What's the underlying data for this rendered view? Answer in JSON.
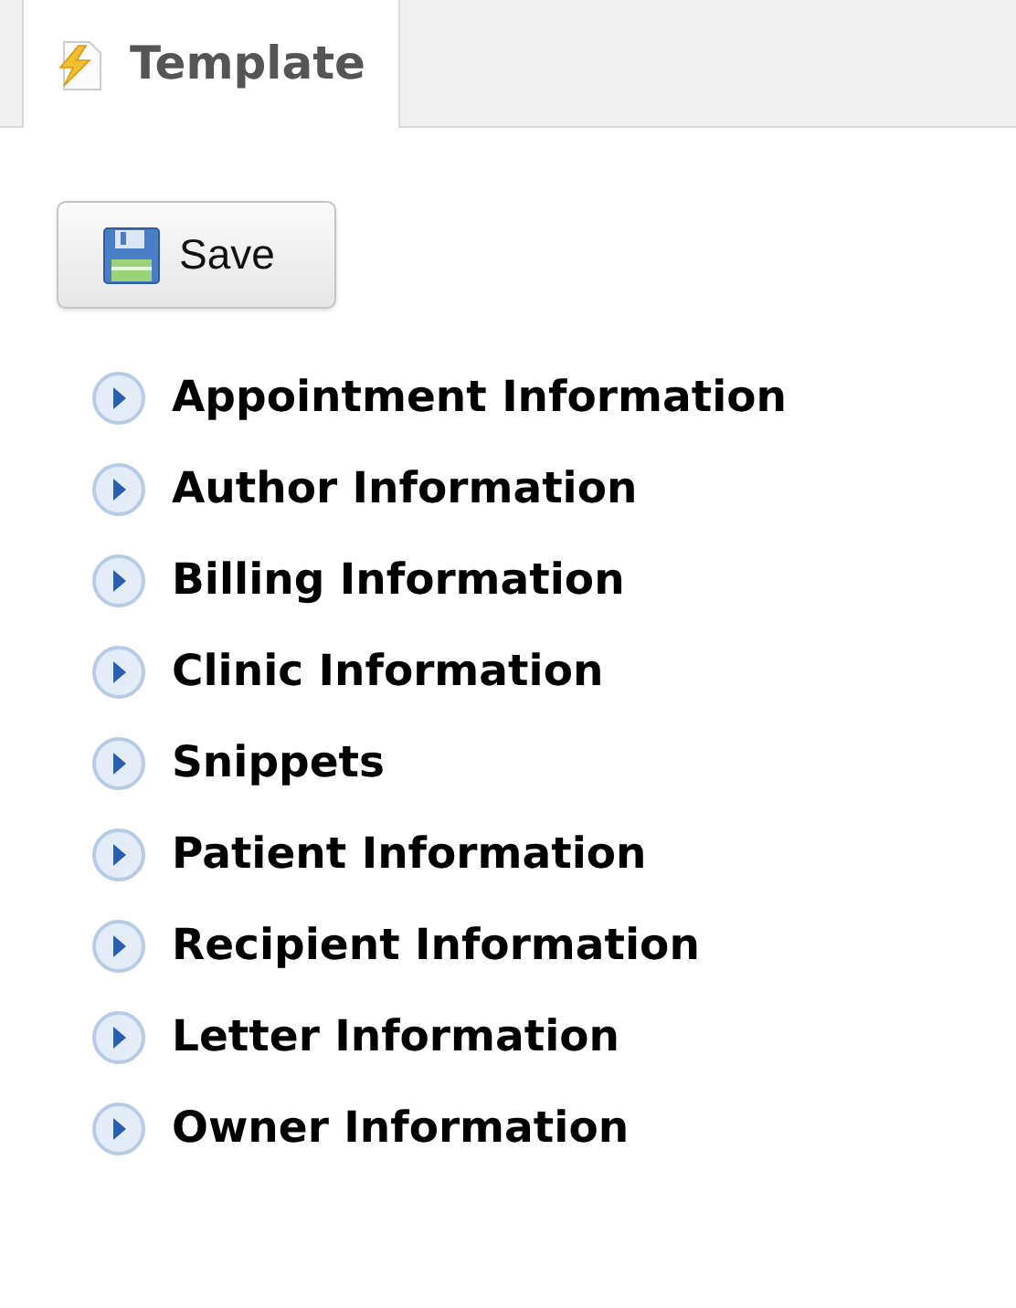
{
  "tabs": [
    {
      "label": "Template",
      "selected": true
    }
  ],
  "save_button": {
    "label": "Save"
  },
  "sections": [
    {
      "label": "Appointment Information",
      "expanded": false
    },
    {
      "label": "Author Information",
      "expanded": false
    },
    {
      "label": "Billing Information",
      "expanded": false
    },
    {
      "label": "Clinic Information",
      "expanded": false
    },
    {
      "label": "Snippets",
      "expanded": false
    },
    {
      "label": "Patient Information",
      "expanded": false
    },
    {
      "label": "Recipient Information",
      "expanded": false
    },
    {
      "label": "Letter Information",
      "expanded": false
    },
    {
      "label": "Owner Information",
      "expanded": false
    }
  ]
}
